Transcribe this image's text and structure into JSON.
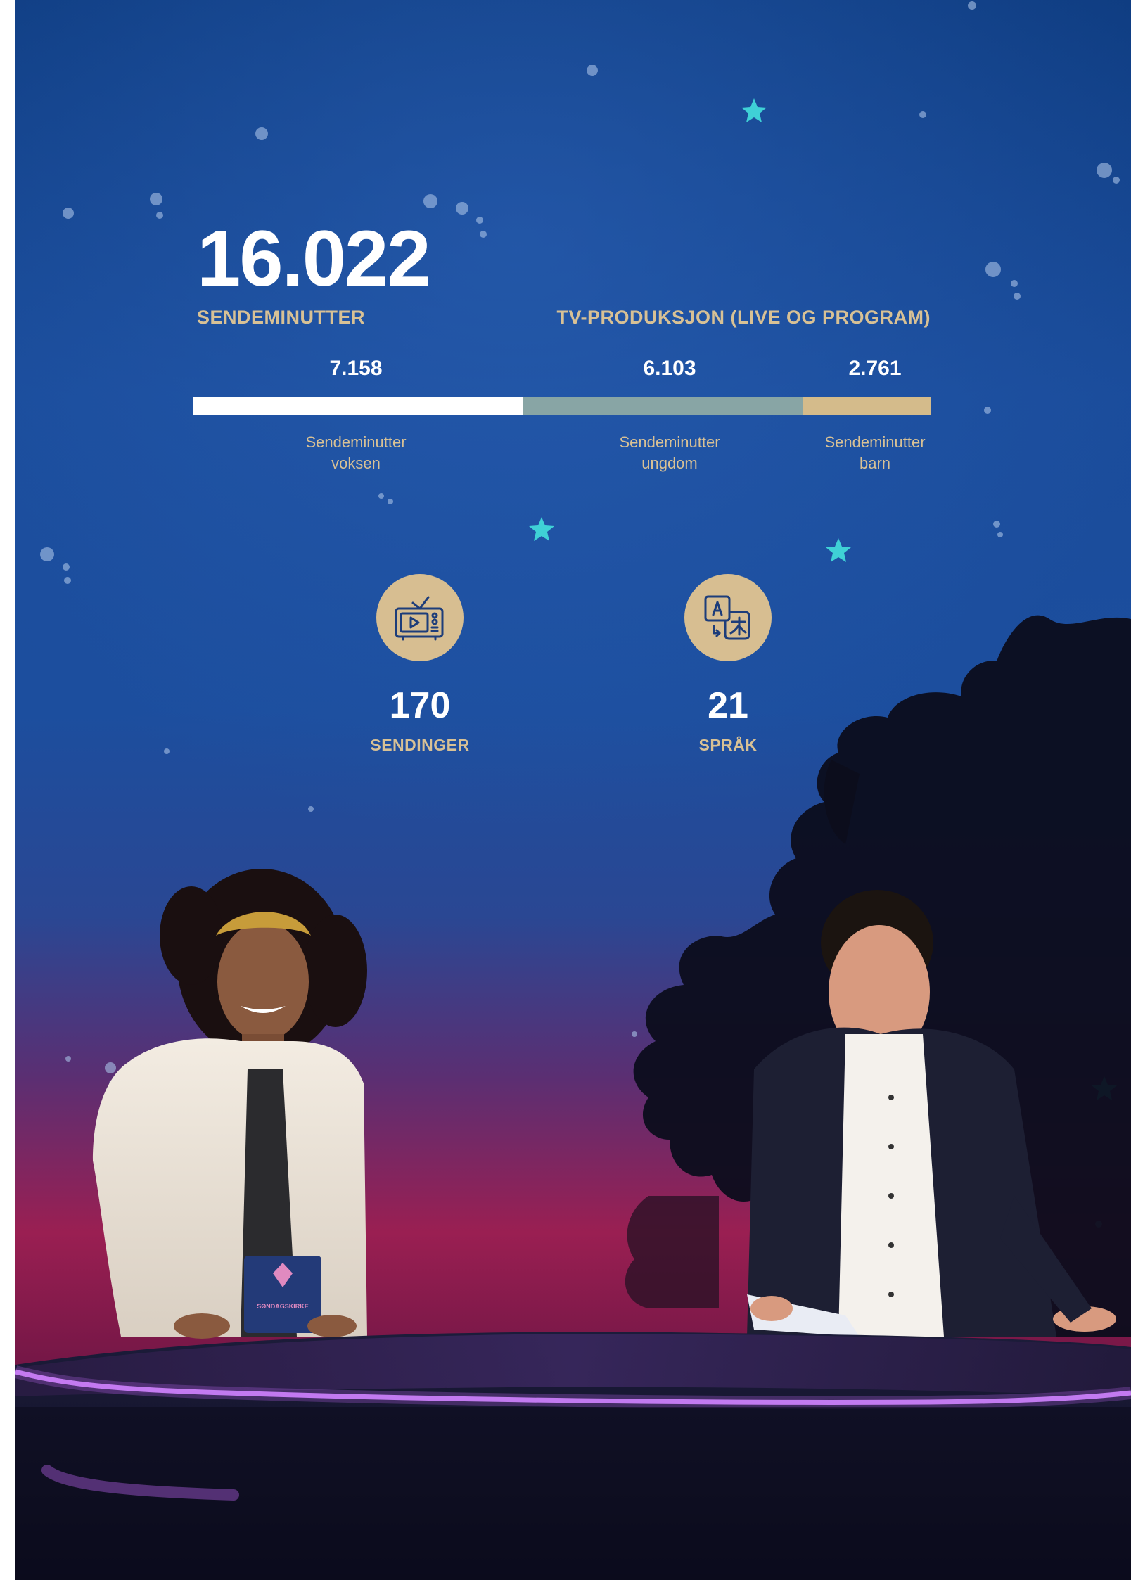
{
  "headline": {
    "value": "16.022",
    "label": "SENDEMINUTTER"
  },
  "section_label": "TV-PRODUKSJON (LIVE OG PROGRAM)",
  "breakdown": {
    "unit": "Sendeminutter",
    "segments": [
      {
        "key": "adult",
        "value_text": "7.158",
        "value": 7158,
        "caption_line1": "Sendeminutter",
        "caption_line2": "voksen",
        "color": "#ffffff"
      },
      {
        "key": "youth",
        "value_text": "6.103",
        "value": 6103,
        "caption_line1": "Sendeminutter",
        "caption_line2": "ungdom",
        "color": "#88a5a5"
      },
      {
        "key": "child",
        "value_text": "2.761",
        "value": 2761,
        "caption_line1": "Sendeminutter",
        "caption_line2": "barn",
        "color": "#d4bb8b"
      }
    ]
  },
  "stats": {
    "broadcasts": {
      "icon": "tv-play-icon",
      "value": "170",
      "label": "SENDINGER"
    },
    "languages": {
      "icon": "translate-icon",
      "value": "21",
      "label": "SPRÅK"
    }
  },
  "desk_card_text": "SØNDAGSKIRKE",
  "colors": {
    "accent_gold": "#d8c195",
    "circle_gold": "#d7be91",
    "sky_top": "#0d3a7d",
    "sky_mid": "#1d4fa1",
    "sky_bottom": "#a11e4b",
    "neon": "#c86bff"
  }
}
